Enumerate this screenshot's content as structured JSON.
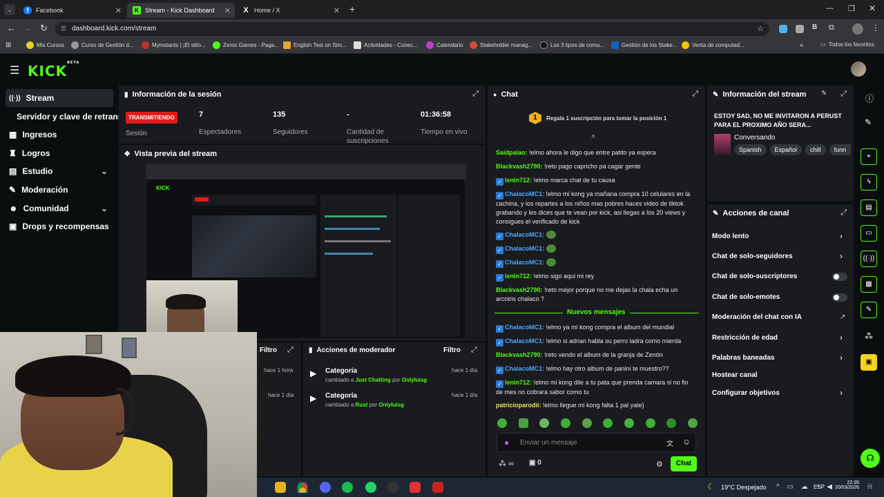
{
  "browser": {
    "tabs": [
      {
        "title": "Facebook"
      },
      {
        "title": "Stream - Kick Dashboard"
      },
      {
        "title": "Home / X"
      }
    ],
    "url": "dashboard.kick.com/stream",
    "bookmarks": [
      "Mis Cursos",
      "Curso de Gestión d...",
      "Myinstants | ¡El sitio...",
      "Zerox Games - Paga...",
      "English Test on Sim...",
      "Actividades - Conec...",
      "Calendario",
      "Stakeholder manag...",
      "Los 3 tipos de comu...",
      "Gestión de los Stake...",
      "Venta de computad..."
    ],
    "bookmarks_all": "Todos los favoritos"
  },
  "kick": {
    "logo": "KICK",
    "logo_badge": "BETA"
  },
  "sidebar": {
    "items": [
      {
        "label": "Stream",
        "icon": "broadcast-icon"
      },
      {
        "label": "Servidor y clave de retransmisión"
      },
      {
        "label": "Ingresos",
        "icon": "chart-icon"
      },
      {
        "label": "Logros",
        "icon": "trophy-icon"
      },
      {
        "label": "Estudio",
        "icon": "studio-icon"
      },
      {
        "label": "Moderación",
        "icon": "wrench-icon"
      },
      {
        "label": "Comunidad",
        "icon": "people-icon"
      },
      {
        "label": "Drops y recompensas",
        "icon": "gift-icon"
      }
    ]
  },
  "session": {
    "title": "Información de la sesión",
    "status": "TRANSMITIENDO",
    "status_label": "Sesión",
    "stats": [
      {
        "value": "7",
        "label": "Espectadores"
      },
      {
        "value": "135",
        "label": "Seguidores"
      },
      {
        "value": "-",
        "label": "Cantidad de suscripciones"
      },
      {
        "value": "01:36:58",
        "label": "Tiempo en vivo"
      }
    ]
  },
  "preview": {
    "title": "Vista previa del stream"
  },
  "filters": {
    "left_title": "Filtro",
    "left_times": [
      "hace 1 hora",
      "hace 1 día"
    ]
  },
  "mod_actions": {
    "title": "Acciones de moderador",
    "filter": "Filtro",
    "items": [
      {
        "title": "Categoría",
        "prefix": "cambiado a",
        "value": "Just Chatting",
        "by": "por",
        "user": "Onlyluisg",
        "time": "hace 1 día"
      },
      {
        "title": "Categoría",
        "prefix": "cambiado a",
        "value": "Rust",
        "by": "por",
        "user": "Onlyluisg",
        "time": "hace 1 día"
      }
    ]
  },
  "chat": {
    "title": "Chat",
    "sub_gift": "Regala 1 suscripción para tomar la posición 1",
    "sub_gift_badge": "1",
    "messages": [
      {
        "user": "Saidpalao:",
        "color": "g",
        "badge": false,
        "text": "!elmo ahora le digo que entre patito ya espera"
      },
      {
        "user": "Blackvash2790:",
        "color": "g",
        "badge": false,
        "text": "!reto pago capricho pa cagar gente"
      },
      {
        "user": "lenin712:",
        "color": "g",
        "badge": true,
        "text": "!elmo marca chat de tu causa"
      },
      {
        "user": "ChalacoMC1:",
        "color": "b",
        "badge": true,
        "text": "!elmo mi kong ya mañana compra 10 celulares en la cachina, y los repartes a los niños mas pobres haces video de tiktok grabando y les dices que te vean por kick, asi llegas a los 20 views y consigues el verificado de kick"
      },
      {
        "user": "ChalacoMC1:",
        "color": "b",
        "badge": true,
        "text": "",
        "emote": true
      },
      {
        "user": "ChalacoMC1:",
        "color": "b",
        "badge": true,
        "text": "",
        "emote": true
      },
      {
        "user": "ChalacoMC1:",
        "color": "b",
        "badge": true,
        "text": "",
        "emote": true
      },
      {
        "user": "lenin712:",
        "color": "g",
        "badge": true,
        "text": "!elmo sigo aqui mi rey"
      },
      {
        "user": "Blackvash2790:",
        "color": "g",
        "badge": false,
        "text": "!reto mejor porque no me dejas la chala echa un arcoiris chalaco ?"
      }
    ],
    "new_messages": "Nuevos mensajes",
    "new": [
      {
        "user": "ChalacoMC1:",
        "color": "b",
        "badge": true,
        "text": "!elmo ya mi kong compra el album del mundial"
      },
      {
        "user": "ChalacoMC1:",
        "color": "b",
        "badge": true,
        "text": "!elmo si adrian habla su perro ladra como mierda"
      },
      {
        "user": "Blackvash2790:",
        "color": "g",
        "badge": false,
        "text": "!reto vendo el album de la granja de Zenón"
      },
      {
        "user": "ChalacoMC1:",
        "color": "b",
        "badge": true,
        "text": "!elmo hay otro album de panini te muestro??"
      },
      {
        "user": "lenin712:",
        "color": "g",
        "badge": true,
        "text": "!elmo mi kong dile a tu pata que prenda camara si no fin de mes no cobrara sabor como tu"
      },
      {
        "user": "patricioparodii:",
        "color": "y",
        "badge": false,
        "text": "!elmo llegue mi kong falta 1 pal yate}"
      }
    ],
    "input_placeholder": "Enviar un mensaje",
    "points": "∞",
    "gifts": "0",
    "send": "Chat"
  },
  "stream_info": {
    "title": "Información del stream",
    "stream_title": "ESTOY SAD, NO ME INVITARON A PERUST PARA EL PROXIMO AÑO SERA...",
    "category": "Conversando",
    "tags": [
      "Spanish",
      "Español",
      "chill",
      "funn"
    ]
  },
  "channel_actions": {
    "title": "Acciones de canal",
    "items": [
      {
        "label": "Modo lento",
        "control": "chevron"
      },
      {
        "label": "Chat de solo-seguidores",
        "control": "chevron"
      },
      {
        "label": "Chat de solo-suscriptores",
        "control": "toggle"
      },
      {
        "label": "Chat de solo-emotes",
        "control": "toggle"
      },
      {
        "label": "Moderación del chat con IA",
        "control": "external"
      },
      {
        "label": "Restricción de edad",
        "control": "chevron"
      },
      {
        "label": "Palabras baneadas",
        "control": "chevron"
      },
      {
        "label": "Hostear canal",
        "control": "none"
      },
      {
        "label": "Configurar objetivos",
        "control": "chevron"
      }
    ]
  },
  "taskbar": {
    "weather": "19°C  Despejado",
    "lang": "ESP",
    "time": "22:35",
    "date": "20/03/2026"
  },
  "colors": {
    "accent": "#53fc18",
    "live": "#e11b1b",
    "panel": "#191b1f",
    "bg": "#0b0e0f"
  }
}
